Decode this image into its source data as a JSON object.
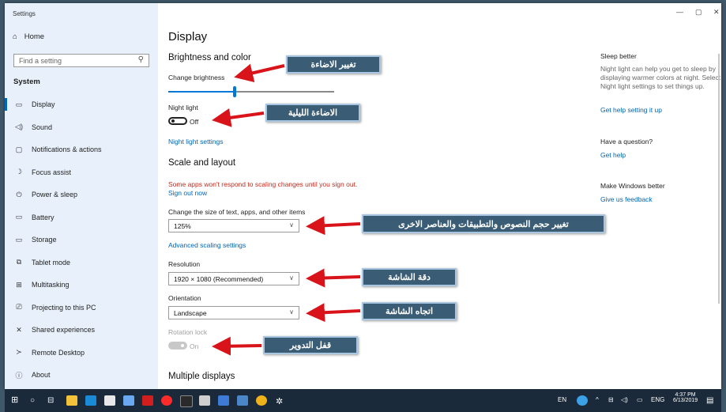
{
  "window": {
    "title": "Settings",
    "controls": [
      "—",
      "▢",
      "✕"
    ]
  },
  "sidebar": {
    "home": "Home",
    "search_placeholder": "Find a setting",
    "section": "System",
    "items": [
      {
        "label": "Display",
        "icon": "monitor-icon",
        "glyph": "▭",
        "active": true
      },
      {
        "label": "Sound",
        "icon": "speaker-icon",
        "glyph": "◁)",
        "active": false
      },
      {
        "label": "Notifications & actions",
        "icon": "notification-icon",
        "glyph": "▢",
        "active": false
      },
      {
        "label": "Focus assist",
        "icon": "moon-icon",
        "glyph": "☽",
        "active": false
      },
      {
        "label": "Power & sleep",
        "icon": "power-icon",
        "glyph": "⏻",
        "active": false
      },
      {
        "label": "Battery",
        "icon": "battery-icon",
        "glyph": "▭",
        "active": false
      },
      {
        "label": "Storage",
        "icon": "storage-icon",
        "glyph": "▭",
        "active": false
      },
      {
        "label": "Tablet mode",
        "icon": "tablet-icon",
        "glyph": "⧉",
        "active": false
      },
      {
        "label": "Multitasking",
        "icon": "multitasking-icon",
        "glyph": "⊞",
        "active": false
      },
      {
        "label": "Projecting to this PC",
        "icon": "projector-icon",
        "glyph": "⎚",
        "active": false
      },
      {
        "label": "Shared experiences",
        "icon": "share-icon",
        "glyph": "✕",
        "active": false
      },
      {
        "label": "Remote Desktop",
        "icon": "remote-desktop-icon",
        "glyph": "≻",
        "active": false
      },
      {
        "label": "About",
        "icon": "info-icon",
        "glyph": "ⓘ",
        "active": false
      }
    ]
  },
  "main": {
    "title": "Display",
    "brightness_heading": "Brightness and color",
    "change_brightness": "Change brightness",
    "brightness_level": 0.4,
    "night_light_label": "Night light",
    "night_light_state": "Off",
    "night_light_settings": "Night light settings",
    "scale_heading": "Scale and layout",
    "scale_warning": "Some apps won't respond to scaling changes until you sign out.",
    "sign_out_now": "Sign out now",
    "change_size_label": "Change the size of text, apps, and other items",
    "scale_value": "125%",
    "advanced_scaling": "Advanced scaling settings",
    "resolution_label": "Resolution",
    "resolution_value": "1920 × 1080 (Recommended)",
    "orientation_label": "Orientation",
    "orientation_value": "Landscape",
    "rotation_lock_label": "Rotation lock",
    "rotation_lock_state": "On",
    "multiple_displays": "Multiple displays"
  },
  "right": {
    "sleep_heading": "Sleep better",
    "sleep_text": "Night light can help you get to sleep by displaying warmer colors at night. Select Night light settings to set things up.",
    "sleep_link": "Get help setting it up",
    "question_heading": "Have a question?",
    "question_link": "Get help",
    "better_heading": "Make Windows better",
    "better_link": "Give us feedback"
  },
  "callouts": {
    "brightness": "تغيير الاضاءة",
    "night_light": "الاضاءة الليلية",
    "scale": "تغيير حجم النصوص والتطبيقات والعناصر الاخرى",
    "resolution": "دقة الشاشة",
    "orientation": "اتجاه الشاشة",
    "rotation": "قفل التدوير"
  },
  "taskbar": {
    "lang": "EN",
    "ime": "ENG",
    "time": "4:37 PM",
    "date": "6/13/2019"
  },
  "colors": {
    "accent": "#0078d7",
    "callout_bg": "#3a5d75",
    "arrow": "#d8141a",
    "warning": "#c42b1c",
    "sidebar_bg": "#e8f1fb"
  }
}
